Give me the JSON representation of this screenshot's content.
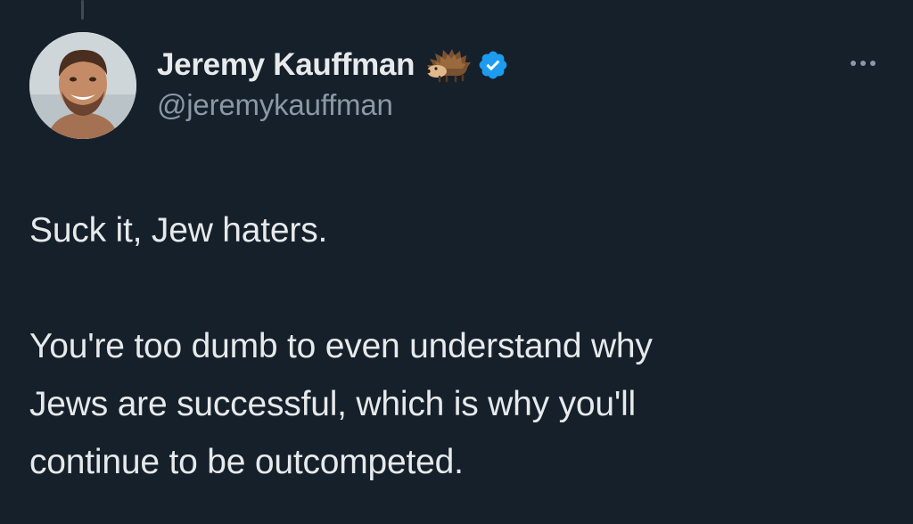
{
  "author": {
    "display_name": "Jeremy Kauffman",
    "handle": "@jeremykauffman",
    "name_emoji_icon": "hedgehog-icon",
    "verified_icon": "verified-badge-icon",
    "avatar_icon": "profile-photo"
  },
  "tweet": {
    "paragraph_1": "Suck it, Jew haters.",
    "paragraph_2_line_1": "You're too dumb to even understand why",
    "paragraph_2_line_2": "Jews are successful, which is why you'll",
    "paragraph_2_line_3": "continue to be outcompeted."
  },
  "actions": {
    "more_icon": "more-options-icon"
  },
  "colors": {
    "background": "#15202b",
    "primary_text": "#e7e9ea",
    "secondary_text": "#8b98a5",
    "verified_blue": "#1d9bf0"
  }
}
